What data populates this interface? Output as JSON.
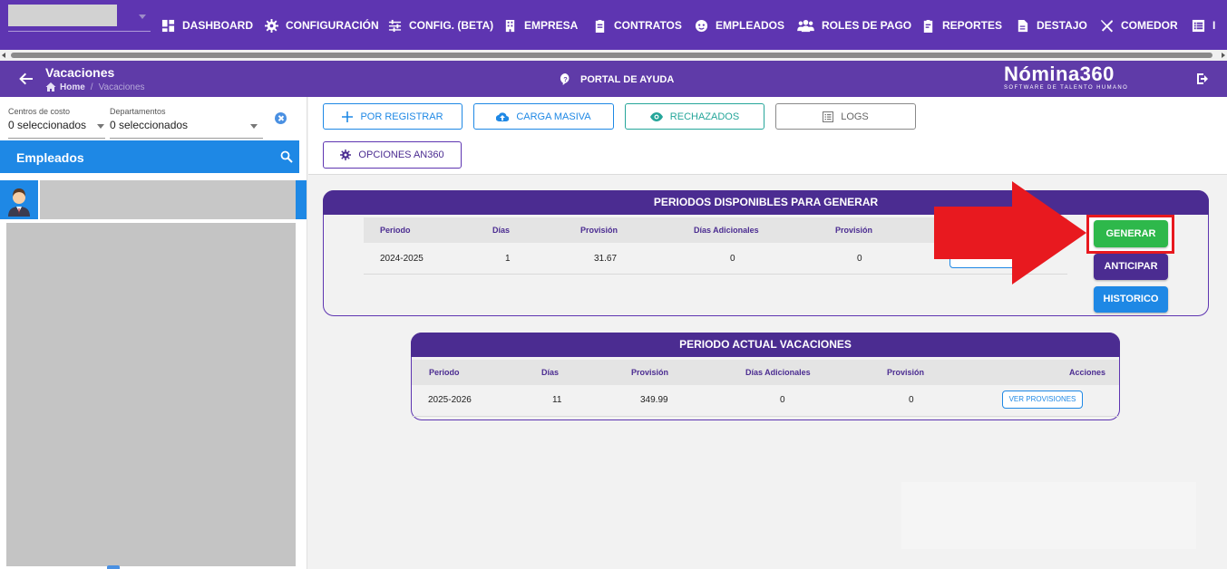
{
  "colors": {
    "primary": "#5e35b1",
    "primary_dark": "#4b2c91",
    "blue": "#1e88e5",
    "teal": "#26a69a",
    "green": "#2eb84b",
    "annotation_red": "#e8191f"
  },
  "nav": {
    "items": [
      {
        "label": "DASHBOARD",
        "icon": "dashboard-icon"
      },
      {
        "label": "CONFIGURACIÓN",
        "icon": "gear-icon"
      },
      {
        "label": "CONFIG. (BETA)",
        "icon": "sliders-icon"
      },
      {
        "label": "EMPRESA",
        "icon": "building-icon"
      },
      {
        "label": "CONTRATOS",
        "icon": "clipboard-icon"
      },
      {
        "label": "EMPLEADOS",
        "icon": "face-icon"
      },
      {
        "label": "ROLES DE PAGO",
        "icon": "people-icon"
      },
      {
        "label": "REPORTES",
        "icon": "report-icon"
      },
      {
        "label": "DESTAJO",
        "icon": "document-icon"
      },
      {
        "label": "COMEDOR",
        "icon": "utensils-icon"
      },
      {
        "label": "I",
        "icon": "list-icon"
      }
    ]
  },
  "header": {
    "title": "Vacaciones",
    "breadcrumb_home": "Home",
    "breadcrumb_sep": "/",
    "breadcrumb_current": "Vacaciones",
    "help": "PORTAL DE AYUDA",
    "brand_name": "Nómina360",
    "brand_sub": "SOFTWARE DE TALENTO HUMANO"
  },
  "sidebar": {
    "filters": [
      {
        "label": "Centros de costo",
        "value": "0 seleccionados"
      },
      {
        "label": "Departamentos",
        "value": "0 seleccionados"
      }
    ],
    "employees_title": "Empleados"
  },
  "toolbar": {
    "por_registrar": "POR REGISTRAR",
    "carga_masiva": "CARGA MASIVA",
    "rechazados": "RECHAZADOS",
    "logs": "LOGS",
    "opciones": "OPCIONES AN360"
  },
  "available": {
    "title": "PERIODOS DISPONIBLES PARA GENERAR",
    "columns": [
      "Periodo",
      "Días",
      "Provisión",
      "Días Adicionales",
      "Provisión"
    ],
    "rows": [
      {
        "periodo": "2024-2025",
        "dias": "1",
        "provision": "31.67",
        "dias_adicionales": "0",
        "provision2": "0"
      }
    ],
    "actions": {
      "generar": "GENERAR",
      "anticipar": "ANTICIPAR",
      "historico": "HISTORICO"
    }
  },
  "current": {
    "title": "PERIODO ACTUAL VACACIONES",
    "columns": [
      "Periodo",
      "Días",
      "Provisión",
      "Días Adicionales",
      "Provisión",
      "Acciones"
    ],
    "rows": [
      {
        "periodo": "2025-2026",
        "dias": "11",
        "provision": "349.99",
        "dias_adicionales": "0",
        "provision2": "0",
        "action": "VER PROVISIONES"
      }
    ]
  }
}
